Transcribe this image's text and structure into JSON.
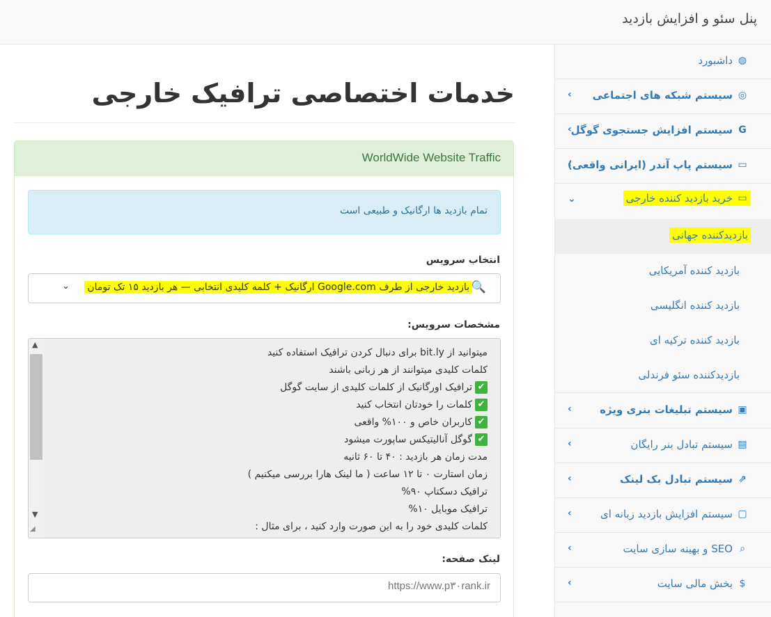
{
  "header": {
    "brand": "پنل سئو و افزایش بازدید"
  },
  "sidebar": {
    "items": [
      {
        "label": "داشبورد",
        "icon": "dashboard-icon",
        "glyph": "◍",
        "bold": false,
        "chevron": ""
      },
      {
        "label": "سیستم شبکه های اجتماعی",
        "icon": "instagram-icon",
        "glyph": "◎",
        "bold": true,
        "chevron": "›"
      },
      {
        "label": "سیستم افزایش جستجوی گوگل",
        "icon": "google-icon",
        "glyph": "G",
        "bold": true,
        "chevron": "›"
      },
      {
        "label": "سیستم پاپ آندر (ایرانی واقعی)",
        "icon": "desktop-icon",
        "glyph": "▭",
        "bold": true,
        "chevron": "›"
      },
      {
        "label": "خرید بازدید کننده خارجی",
        "icon": "desktop-icon",
        "glyph": "▭",
        "bold": false,
        "chevron": "⌄"
      }
    ],
    "subitems": [
      {
        "label": "بازدیدکننده جهانی"
      },
      {
        "label": "بازدید کننده آمریکایی"
      },
      {
        "label": "بازدید کننده انگلیسی"
      },
      {
        "label": "بازدید کننده ترکیه ای"
      },
      {
        "label": "بازدیدکننده سئو فرندلی"
      }
    ],
    "items2": [
      {
        "label": "سیستم تبلیغات بنری ویژه",
        "icon": "banner-icon",
        "glyph": "▣",
        "bold": true
      },
      {
        "label": "سیستم تبادل بنر رایگان",
        "icon": "exchange-icon",
        "glyph": "▤",
        "bold": false
      },
      {
        "label": "سیستم تبادل بک لینک",
        "icon": "external-link-icon",
        "glyph": "⇗",
        "bold": true
      },
      {
        "label": "سیستم افزایش بازدید زبانه ای",
        "icon": "folder-icon",
        "glyph": "▢",
        "bold": false
      },
      {
        "label": "SEO و بهینه سازی سایت",
        "icon": "search-icon",
        "glyph": "⌕",
        "bold": false
      },
      {
        "label": "بخش مالی سایت",
        "icon": "money-icon",
        "glyph": "$",
        "bold": false
      }
    ],
    "chevron": "›"
  },
  "main": {
    "title": "خدمات اختصاصی ترافیک خارجی",
    "panel_heading": "WorldWide Website Traffic",
    "alert": "تمام بازدید ها ارگانیک و طبیعی است",
    "service_label": "انتخاب سرویس",
    "service_value": "بازدید خارجی از طرف Google.com ارگانیک + کلمه کلیدی انتخابی — هر بازدید ۱۵ تک تومان",
    "service_glyph": "🔍",
    "service_arrow": "⌄",
    "specs_label": "مشخصات سرویس:",
    "specs_lines": [
      {
        "check": false,
        "text": "میتوانید از bit.ly برای دنبال کردن ترافیک استفاده کنید"
      },
      {
        "check": false,
        "text": "کلمات کلیدی میتوانند از هر زبانی باشند"
      },
      {
        "check": true,
        "text": "ترافیک اورگانیک از کلمات کلیدی از سایت گوگل"
      },
      {
        "check": true,
        "text": "کلمات را خودتان انتخاب کنید"
      },
      {
        "check": true,
        "text": "کاربران خاص و ۱۰۰% واقعی"
      },
      {
        "check": true,
        "text": "گوگل آنالیتیکس ساپورت میشود"
      },
      {
        "check": false,
        "text": "مدت زمان هر بازدید : ۴۰ تا ۶۰ ثانیه"
      },
      {
        "check": false,
        "text": "زمان استارت ۰ تا ۱۲ ساعت ( ما لینک هارا بررسی میکنیم )"
      },
      {
        "check": false,
        "text": "ترافیک دسکتاپ ۹۰%"
      },
      {
        "check": false,
        "text": "ترافیک موبایل ۱۰%"
      },
      {
        "check": false,
        "text": "کلمات کلیدی خود را به این صورت وارد کنید ، برای مثال :"
      }
    ],
    "check_glyph": "✔",
    "link_label": "لینک صفحه:",
    "link_placeholder": "https://www.p۳۰rank.ir"
  },
  "colors": {
    "link": "#337ab7",
    "highlight": "#ffff00",
    "panel_green": "#dff0d8",
    "alert_blue": "#d9edf7",
    "check_green": "#3cb43c"
  }
}
